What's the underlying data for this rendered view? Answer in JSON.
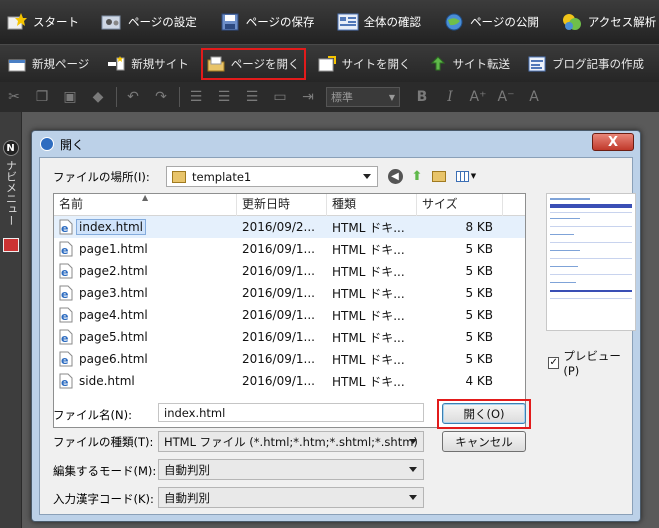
{
  "topbar": {
    "items": [
      {
        "label": "スタート",
        "icon": "star-icon"
      },
      {
        "label": "ページの設定",
        "icon": "page-settings-icon"
      },
      {
        "label": "ページの保存",
        "icon": "save-disk-icon"
      },
      {
        "label": "全体の確認",
        "icon": "overview-icon"
      },
      {
        "label": "ページの公開",
        "icon": "globe-icon"
      },
      {
        "label": "アクセス解析",
        "icon": "analytics-icon"
      }
    ]
  },
  "secondbar": {
    "items": [
      {
        "label": "新規ページ",
        "icon": "new-page-icon"
      },
      {
        "label": "新規サイト",
        "icon": "new-site-icon"
      },
      {
        "label": "ページを開く",
        "icon": "open-folder-icon",
        "highlighted": true
      },
      {
        "label": "サイトを開く",
        "icon": "open-site-icon"
      },
      {
        "label": "サイト転送",
        "icon": "transfer-icon"
      },
      {
        "label": "ブログ記事の作成",
        "icon": "blog-icon"
      }
    ]
  },
  "formatbar": {
    "style_select": "標準"
  },
  "sidenav": {
    "badge": "N",
    "label": "ナビメニュー"
  },
  "dialog": {
    "title": "開く",
    "close_label": "X",
    "location_label": "ファイルの場所(I):",
    "location_value": "template1",
    "columns": [
      "名前",
      "更新日時",
      "種類",
      "サイズ"
    ],
    "files": [
      {
        "name": "index.html",
        "date": "2016/09/2...",
        "type": "HTML ドキ...",
        "size": "8 KB",
        "selected": true
      },
      {
        "name": "page1.html",
        "date": "2016/09/1...",
        "type": "HTML ドキ...",
        "size": "5 KB"
      },
      {
        "name": "page2.html",
        "date": "2016/09/1...",
        "type": "HTML ドキ...",
        "size": "5 KB"
      },
      {
        "name": "page3.html",
        "date": "2016/09/1...",
        "type": "HTML ドキ...",
        "size": "5 KB"
      },
      {
        "name": "page4.html",
        "date": "2016/09/1...",
        "type": "HTML ドキ...",
        "size": "5 KB"
      },
      {
        "name": "page5.html",
        "date": "2016/09/1...",
        "type": "HTML ドキ...",
        "size": "5 KB"
      },
      {
        "name": "page6.html",
        "date": "2016/09/1...",
        "type": "HTML ドキ...",
        "size": "5 KB"
      },
      {
        "name": "side.html",
        "date": "2016/09/1...",
        "type": "HTML ドキ...",
        "size": "4 KB"
      }
    ],
    "preview_label": "プレビュー(P)",
    "preview_checked": true,
    "filename_label": "ファイル名(N):",
    "filename_value": "index.html",
    "filetype_label": "ファイルの種類(T):",
    "filetype_value": "HTML ファイル (*.html;*.htm;*.shtml;*.shtm)",
    "editmode_label": "編集するモード(M):",
    "editmode_value": "自動判別",
    "encoding_label": "入力漢字コード(K):",
    "encoding_value": "自動判別",
    "open_button": "開く(O)",
    "cancel_button": "キャンセル"
  },
  "colors": {
    "highlight": "#e21b1b",
    "dialog_frame": "#bcd1e8",
    "selection": "#cfe3fb"
  }
}
